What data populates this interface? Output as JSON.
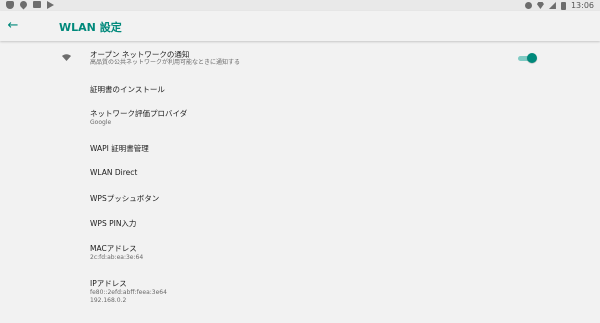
{
  "status_bar": {
    "time": "13:06",
    "left_icons": [
      "shield-icon",
      "location-pin-icon",
      "image-icon",
      "play-store-icon"
    ],
    "right_icons": [
      "do-not-disturb-icon",
      "wifi-icon",
      "signal-icon",
      "battery-icon"
    ]
  },
  "app_bar": {
    "back_icon": "arrow-back-icon",
    "title": "WLAN 設定",
    "accent_color": "#00897b"
  },
  "settings": {
    "open_network": {
      "title": "オープン ネットワークの通知",
      "subtitle": "高品質の公共ネットワークが利用可能なときに通知する",
      "toggle_on": true
    },
    "install_cert": {
      "title": "証明書のインストール"
    },
    "network_rating": {
      "title": "ネットワーク評価プロバイダ",
      "subtitle": "Google"
    },
    "wapi_cert": {
      "title": "WAPI 証明書管理"
    },
    "wlan_direct": {
      "title": "WLAN Direct"
    },
    "wps_push": {
      "title": "WPSプッシュボタン"
    },
    "wps_pin": {
      "title": "WPS PIN入力"
    },
    "mac": {
      "title": "MACアドレス",
      "value": "2c:fd:ab:ea:3e:64"
    },
    "ip": {
      "title": "IPアドレス",
      "value_v6": "fe80::2efd:abff:feea:3e64",
      "value_v4": "192.168.0.2"
    }
  }
}
